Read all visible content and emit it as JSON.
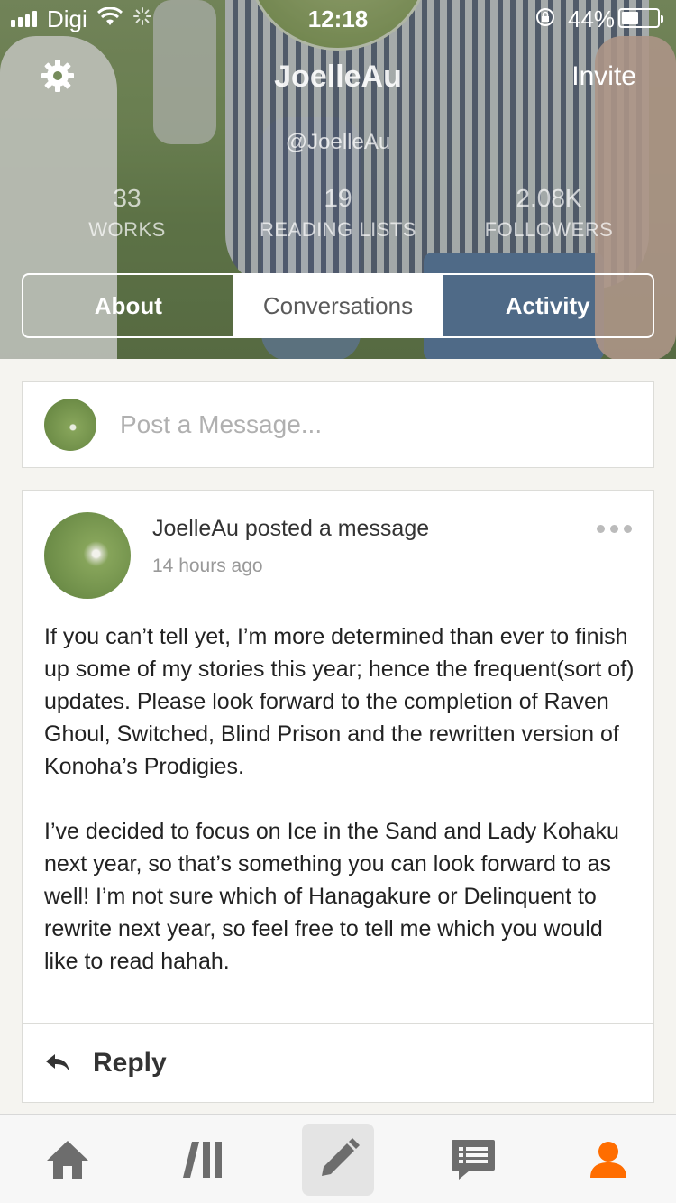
{
  "status_bar": {
    "carrier": "Digi",
    "time": "12:18",
    "battery_percent": "44%"
  },
  "profile": {
    "username": "JoelleAu",
    "handle": "@JoelleAu",
    "invite_label": "Invite",
    "stats": [
      {
        "value": "33",
        "label": "WORKS"
      },
      {
        "value": "19",
        "label": "READING LISTS"
      },
      {
        "value": "2.08K",
        "label": "FOLLOWERS"
      }
    ]
  },
  "tabs": [
    {
      "label": "About",
      "active": false
    },
    {
      "label": "Conversations",
      "active": true
    },
    {
      "label": "Activity",
      "active": false
    }
  ],
  "composer": {
    "placeholder": "Post a Message..."
  },
  "post": {
    "header": "JoelleAu posted a message",
    "time": "14 hours ago",
    "paragraphs": [
      "If you can’t tell yet, I’m more determined than ever to finish up some of my stories this year; hence the frequent(sort of) updates. Please look forward to the completion of Raven Ghoul, Switched, Blind Prison and the rewritten version of Konoha’s Prodigies.",
      "I’ve decided to focus on Ice in the Sand and Lady Kohaku next year, so that’s something you can look forward to as well! I’m not sure which of Hanagakure or Delinquent to rewrite next year, so feel free to tell me which you would like to read hahah."
    ],
    "reply_label": "Reply"
  },
  "bottom_nav": [
    {
      "icon": "home-icon"
    },
    {
      "icon": "library-icon"
    },
    {
      "icon": "write-icon",
      "active": true
    },
    {
      "icon": "messages-icon"
    },
    {
      "icon": "profile-icon",
      "active_color": "#ff6d00"
    }
  ],
  "colors": {
    "accent": "#ff6d00",
    "icon_gray": "#6d6d6d"
  }
}
